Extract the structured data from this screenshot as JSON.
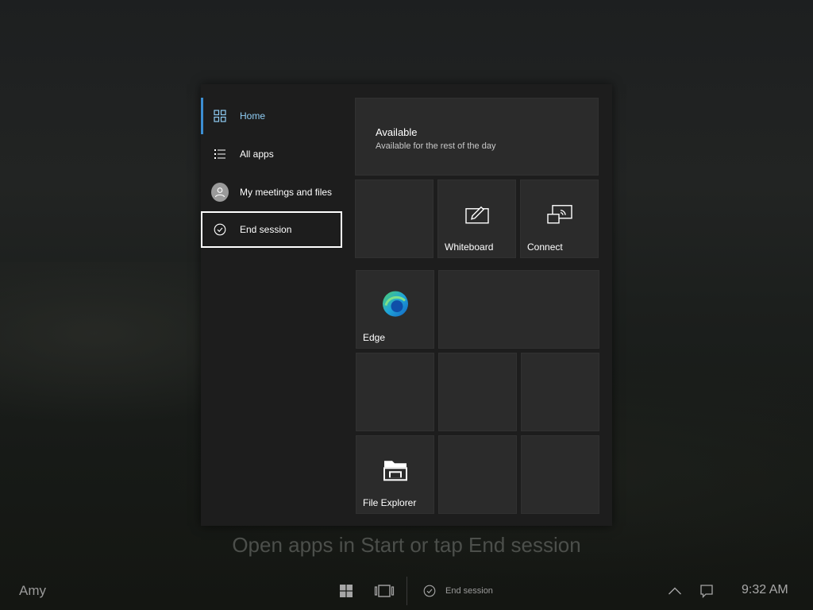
{
  "nav": {
    "items": [
      {
        "label": "Home",
        "icon": "home-tiles-icon"
      },
      {
        "label": "All apps",
        "icon": "list-icon"
      },
      {
        "label": "My meetings and files",
        "icon": "avatar-icon"
      },
      {
        "label": "End session",
        "icon": "check-circle-icon"
      }
    ]
  },
  "status": {
    "title": "Available",
    "subtitle": "Available for the rest of the day"
  },
  "tiles": {
    "whiteboard": {
      "label": "Whiteboard",
      "icon": "whiteboard-pen-icon"
    },
    "connect": {
      "label": "Connect",
      "icon": "cast-screen-icon"
    },
    "edge": {
      "label": "Edge",
      "icon": "edge-logo-icon"
    },
    "file_explorer": {
      "label": "File Explorer",
      "icon": "folder-icon"
    }
  },
  "hint": "Open apps in Start or tap End session",
  "taskbar": {
    "user": "Amy",
    "end_session_label": "End session",
    "clock": "9:32 AM"
  },
  "colors": {
    "accent": "#3c8ed2",
    "selected_text": "#8fcdf5",
    "panel": "#1d1d1d",
    "tile": "#2b2b2b"
  }
}
